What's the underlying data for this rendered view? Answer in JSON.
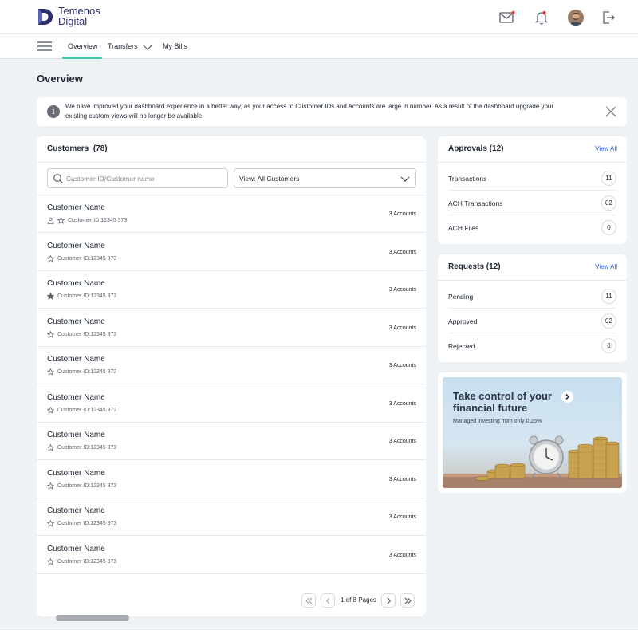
{
  "header": {
    "logo": {
      "line1": "Temenos",
      "line2": "Digital"
    },
    "icons": [
      "mail-icon",
      "bell-icon",
      "avatar",
      "logout-icon"
    ],
    "notification_color": "#e03b3b"
  },
  "nav": {
    "tabs": [
      {
        "label": "Overview",
        "active": true
      },
      {
        "label": "Transfers",
        "has_dropdown": true
      },
      {
        "label": "My Bills"
      }
    ],
    "active_color": "#3ec9a7"
  },
  "page": {
    "title": "Overview"
  },
  "banner": {
    "text": "We have improved your dashboard experience in a better way, as your access to Customer IDs and Accounts are large in number. As a result of the dashboard upgrade your existing custom views will no longer be available"
  },
  "customers": {
    "title": "Customers",
    "count": "(78)",
    "search_placeholder": "Customer ID/Customer name",
    "view_select": "View: All Customers",
    "rows": [
      {
        "name": "Customer Name",
        "id": "Customer ID:12345 373",
        "accounts": "3 Accounts",
        "person": true,
        "star": "outline"
      },
      {
        "name": "Customer Name",
        "id": "Customer ID:12345 373",
        "accounts": "3 Accounts",
        "star": "outline"
      },
      {
        "name": "Customer Name",
        "id": "Customer ID:12345 373",
        "accounts": "3 Accounts",
        "star": "filled"
      },
      {
        "name": "Customer Name",
        "id": "Customer ID:12345 373",
        "accounts": "3 Accounts",
        "star": "outline"
      },
      {
        "name": "Customer Name",
        "id": "Customer ID:12345 373",
        "accounts": "3 Accounts",
        "star": "outline"
      },
      {
        "name": "Customer Name",
        "id": "Customer ID:12345 373",
        "accounts": "3 Accounts",
        "star": "outline"
      },
      {
        "name": "Customer Name",
        "id": "Customer ID:12345 373",
        "accounts": "3 Accounts",
        "star": "outline"
      },
      {
        "name": "Customer Name",
        "id": "Customer ID:12345 373",
        "accounts": "3 Accounts",
        "star": "outline"
      },
      {
        "name": "Customer Name",
        "id": "Customer ID:12345 373",
        "accounts": "3 Accounts",
        "star": "outline"
      },
      {
        "name": "Customer Name",
        "id": "Customer ID:12345 373",
        "accounts": "3 Accounts",
        "star": "outline"
      }
    ],
    "pagination": "1 of 8 Pages"
  },
  "approvals": {
    "title": "Approvals (12)",
    "view_all": "View All",
    "items": [
      {
        "label": "Transactions",
        "count": "11"
      },
      {
        "label": "ACH Transactions",
        "count": "02"
      },
      {
        "label": "ACH Files",
        "count": "0"
      }
    ]
  },
  "requests": {
    "title": "Requests (12)",
    "view_all": "View All",
    "items": [
      {
        "label": "Pending",
        "count": "11"
      },
      {
        "label": "Approved",
        "count": "02"
      },
      {
        "label": "Rejected",
        "count": "0"
      }
    ]
  },
  "promo": {
    "title": "Take control of your financial future",
    "subtitle": "Managed investing from only 0.25%"
  },
  "colors": {
    "link": "#2c5bd6",
    "brand": "#2b2f6b"
  }
}
